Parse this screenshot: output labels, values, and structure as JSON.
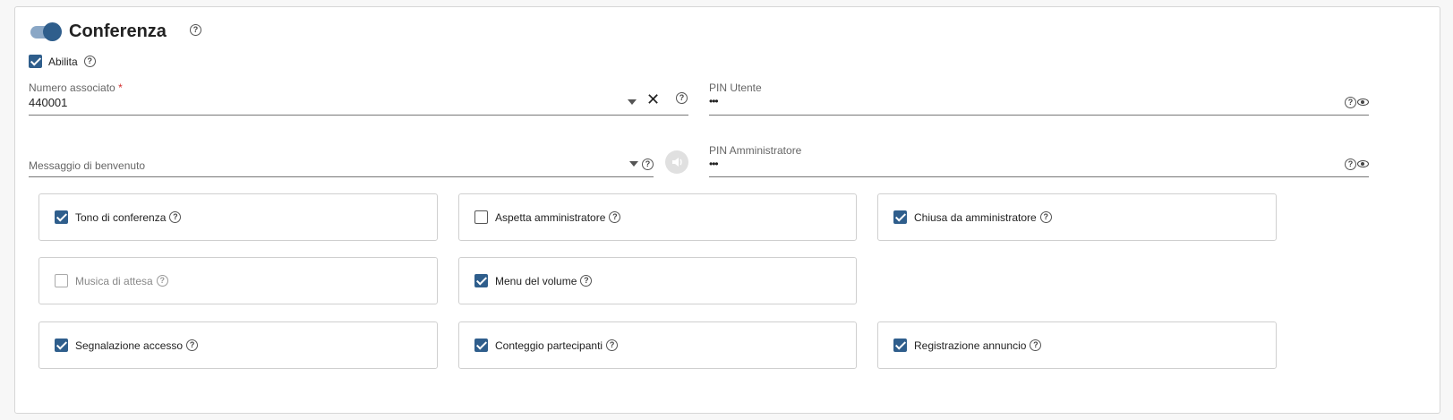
{
  "section": {
    "title": "Conferenza",
    "enabled_toggle": true
  },
  "enable": {
    "label": "Abilita",
    "checked": true
  },
  "fields": {
    "numero_associato": {
      "label": "Numero associato",
      "required_mark": "*",
      "value": "440001"
    },
    "pin_utente": {
      "label": "PIN Utente",
      "value": "•••"
    },
    "messaggio_benvenuto": {
      "label": "Messaggio di benvenuto",
      "value": ""
    },
    "pin_amministratore": {
      "label": "PIN Amministratore",
      "value": "•••"
    }
  },
  "options": [
    {
      "label": "Tono di conferenza",
      "state": "checked"
    },
    {
      "label": "Aspetta amministratore",
      "state": "unchecked"
    },
    {
      "label": "Chiusa da amministratore",
      "state": "checked"
    },
    {
      "label": "Musica di attesa",
      "state": "disabled"
    },
    {
      "label": "Menu del volume",
      "state": "checked"
    },
    {
      "label": "Segnalazione accesso",
      "state": "checked"
    },
    {
      "label": "Conteggio partecipanti",
      "state": "checked"
    },
    {
      "label": "Registrazione annuncio",
      "state": "checked"
    }
  ],
  "icons": {
    "help": "?",
    "clear": "✕"
  },
  "colors": {
    "accent": "#2f5e8c",
    "required": "#d32f2f"
  }
}
